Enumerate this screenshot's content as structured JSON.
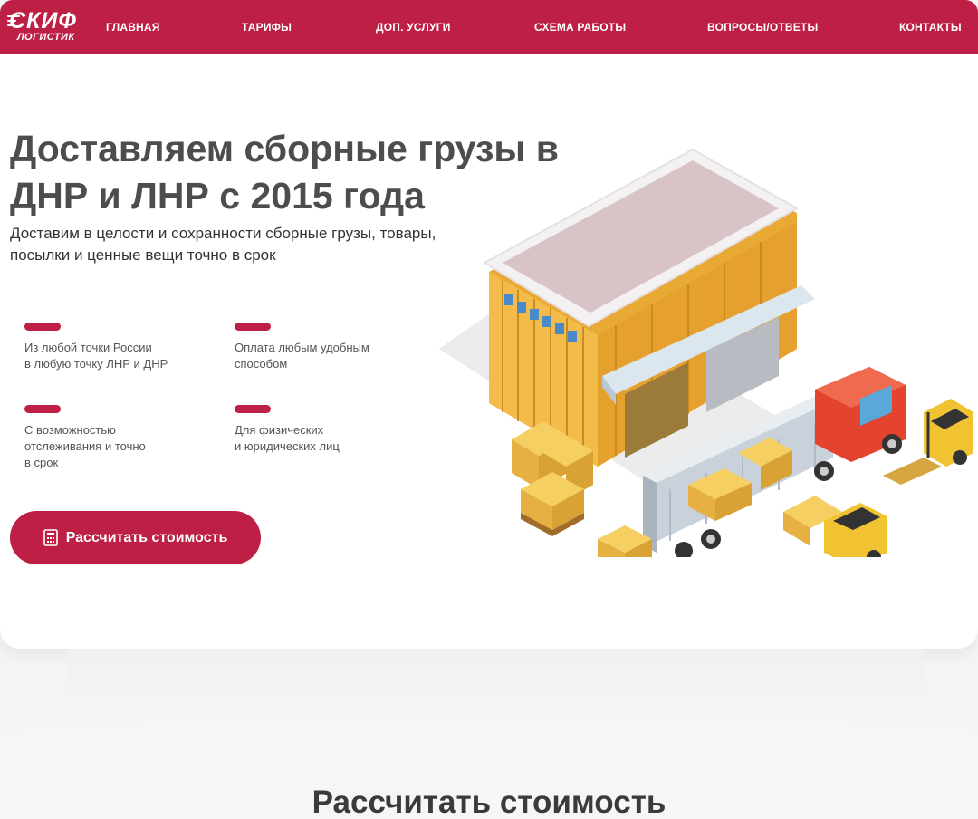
{
  "logo": {
    "top": "СКИФ",
    "bottom": "ЛОГИСТИК"
  },
  "nav": [
    {
      "label": "ГЛАВНАЯ"
    },
    {
      "label": "ТАРИФЫ"
    },
    {
      "label": "ДОП. УСЛУГИ"
    },
    {
      "label": "СХЕМА РАБОТЫ"
    },
    {
      "label": "ВОПРОСЫ/ОТВЕТЫ"
    },
    {
      "label": "КОНТАКТЫ"
    }
  ],
  "hero": {
    "title": "Доставляем сборные грузы в ДНР и ЛНР с 2015 года",
    "subtitle": "Доставим в целости и сохранности сборные грузы, товары, посылки и ценные вещи точно в срок",
    "features": [
      {
        "text": "Из любой точки России\nв любую точку ЛНР и ДНР"
      },
      {
        "text": "Оплата любым удобным\nспособом"
      },
      {
        "text": "С возможностью\nотслеживания и точно\nв срок"
      },
      {
        "text": "Для физических\nи юридических лиц"
      }
    ],
    "cta_label": "Рассчитать стоимость",
    "illustration_icon": "warehouse-truck-forklift-illustration"
  },
  "section": {
    "title": "Рассчитать стоимость"
  },
  "colors": {
    "accent": "#bd1f45",
    "heading": "#4d4d4d",
    "box": "#f0c14b"
  }
}
